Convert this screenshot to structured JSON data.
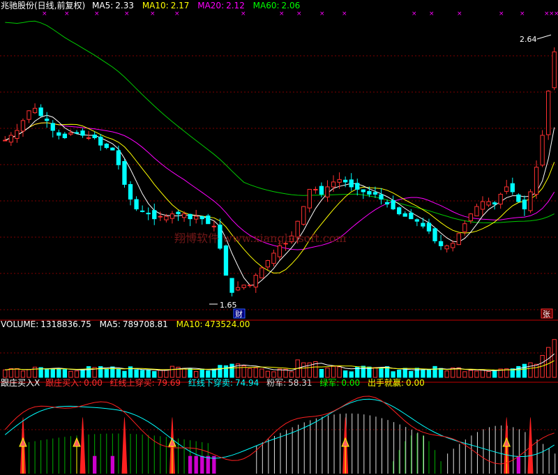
{
  "main": {
    "title": "兆驰股份(日线,前复权)",
    "ma": [
      {
        "label": "MA5:",
        "value": "2.33",
        "color": "#ffffff"
      },
      {
        "label": "MA10:",
        "value": "2.17",
        "color": "#ffff00"
      },
      {
        "label": "MA20:",
        "value": "2.12",
        "color": "#ff00ff"
      },
      {
        "label": "MA60:",
        "value": "2.06",
        "color": "#00ff00"
      }
    ],
    "high_label": "2.64",
    "low_label": "1.65",
    "badge_cai": "财",
    "badge_zhang": "张",
    "watermark": "翔博软件  www.xiangbosoft.com",
    "price_range": [
      1.55,
      2.8
    ],
    "closes": [
      2.28,
      2.3,
      2.32,
      2.36,
      2.4,
      2.41,
      2.38,
      2.36,
      2.32,
      2.3,
      2.29,
      2.31,
      2.31,
      2.3,
      2.29,
      2.29,
      2.26,
      2.25,
      2.24,
      2.18,
      2.1,
      2.04,
      2.0,
      1.99,
      1.98,
      1.96,
      1.97,
      1.97,
      1.98,
      1.98,
      1.98,
      1.96,
      1.97,
      1.96,
      1.94,
      1.93,
      1.84,
      1.73,
      1.66,
      1.68,
      1.69,
      1.69,
      1.73,
      1.76,
      1.79,
      1.82,
      1.85,
      1.86,
      1.89,
      1.95,
      2.01,
      2.08,
      2.08,
      2.06,
      2.09,
      2.11,
      2.12,
      2.11,
      2.09,
      2.08,
      2.07,
      2.06,
      2.06,
      2.04,
      2.02,
      2.0,
      1.98,
      1.97,
      1.96,
      1.95,
      1.93,
      1.91,
      1.87,
      1.85,
      1.85,
      1.86,
      1.9,
      1.94,
      1.98,
      2.01,
      2.03,
      2.03,
      2.02,
      2.06,
      2.09,
      2.07,
      2.03,
      2.0,
      2.07,
      2.17,
      2.3,
      2.48,
      2.64
    ]
  },
  "volume": {
    "label": "VOLUME:",
    "value": "1318836.75",
    "ma5_label": "MA5:",
    "ma5_value": "789708.81",
    "ma10_label": "MA10:",
    "ma10_value": "473524.00"
  },
  "indicator": {
    "name": "跟庄买入X",
    "items": [
      {
        "label": "跟庄买入:",
        "value": "0.00",
        "color": "#ff3030"
      },
      {
        "label": "红线上穿买:",
        "value": "79.69",
        "color": "#ff3030"
      },
      {
        "label": "红线下穿卖:",
        "value": "74.94",
        "color": "#00ffff"
      },
      {
        "label": "粉军:",
        "value": "58.31",
        "color": "#dddddd"
      },
      {
        "label": "绿军:",
        "value": "0.00",
        "color": "#00ff00"
      },
      {
        "label": "出手就赢:",
        "value": "0.00",
        "color": "#ffff00"
      }
    ]
  },
  "colors": {
    "up": "#ff3030",
    "down": "#00ffff",
    "grid": "#800000"
  }
}
